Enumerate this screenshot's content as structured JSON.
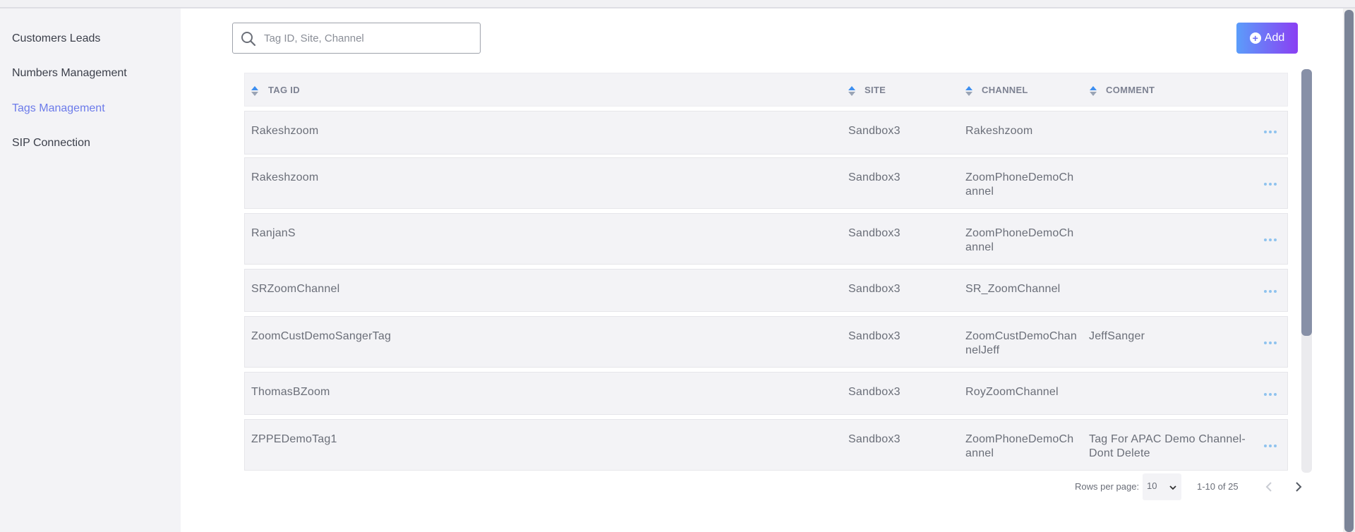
{
  "sidebar": {
    "items": [
      {
        "label": "Customers Leads",
        "active": false
      },
      {
        "label": "Numbers Management",
        "active": false
      },
      {
        "label": "Tags Management",
        "active": true
      },
      {
        "label": "SIP Connection",
        "active": false
      }
    ]
  },
  "search": {
    "placeholder": "Tag ID, Site, Channel",
    "value": ""
  },
  "toolbar": {
    "add_label": "Add"
  },
  "table": {
    "headers": {
      "tag_id": "TAG ID",
      "site": "SITE",
      "channel": "CHANNEL",
      "comment": "COMMENT"
    },
    "rows": [
      {
        "tag_id": "Rakeshzoom",
        "site": "Sandbox3",
        "channel": "Rakeshzoom",
        "comment": ""
      },
      {
        "tag_id": "Rakeshzoom",
        "site": "Sandbox3",
        "channel": "ZoomPhoneDemoChannel",
        "comment": ""
      },
      {
        "tag_id": "RanjanS",
        "site": "Sandbox3",
        "channel": "ZoomPhoneDemoChannel",
        "comment": ""
      },
      {
        "tag_id": "SRZoomChannel",
        "site": "Sandbox3",
        "channel": "SR_ZoomChannel",
        "comment": ""
      },
      {
        "tag_id": "ZoomCustDemoSangerTag",
        "site": "Sandbox3",
        "channel": "ZoomCustDemoChannelJeff",
        "comment": "JeffSanger"
      },
      {
        "tag_id": "ThomasBZoom",
        "site": "Sandbox3",
        "channel": "RoyZoomChannel",
        "comment": ""
      },
      {
        "tag_id": "ZPPEDemoTag1",
        "site": "Sandbox3",
        "channel": "ZoomPhoneDemoChannel",
        "comment": "Tag For APAC Demo Channel- Dont Delete"
      }
    ]
  },
  "pagination": {
    "rows_per_page_label": "Rows per page:",
    "rows_per_page_value": "10",
    "range_text": "1-10 of 25"
  },
  "colors": {
    "accent": "#6c7bea",
    "add_gradient_start": "#5b9dfa",
    "add_gradient_end": "#8a3ff3",
    "sort_up": "#3d8ff0",
    "sort_down": "#9aa4b5"
  },
  "icons": {
    "search": "search-icon",
    "add": "plus-circle-icon",
    "sort": "sort-icon",
    "row_menu": "more-horizontal-icon",
    "prev": "chevron-left-icon",
    "next": "chevron-right-icon",
    "select": "chevron-down-icon"
  }
}
